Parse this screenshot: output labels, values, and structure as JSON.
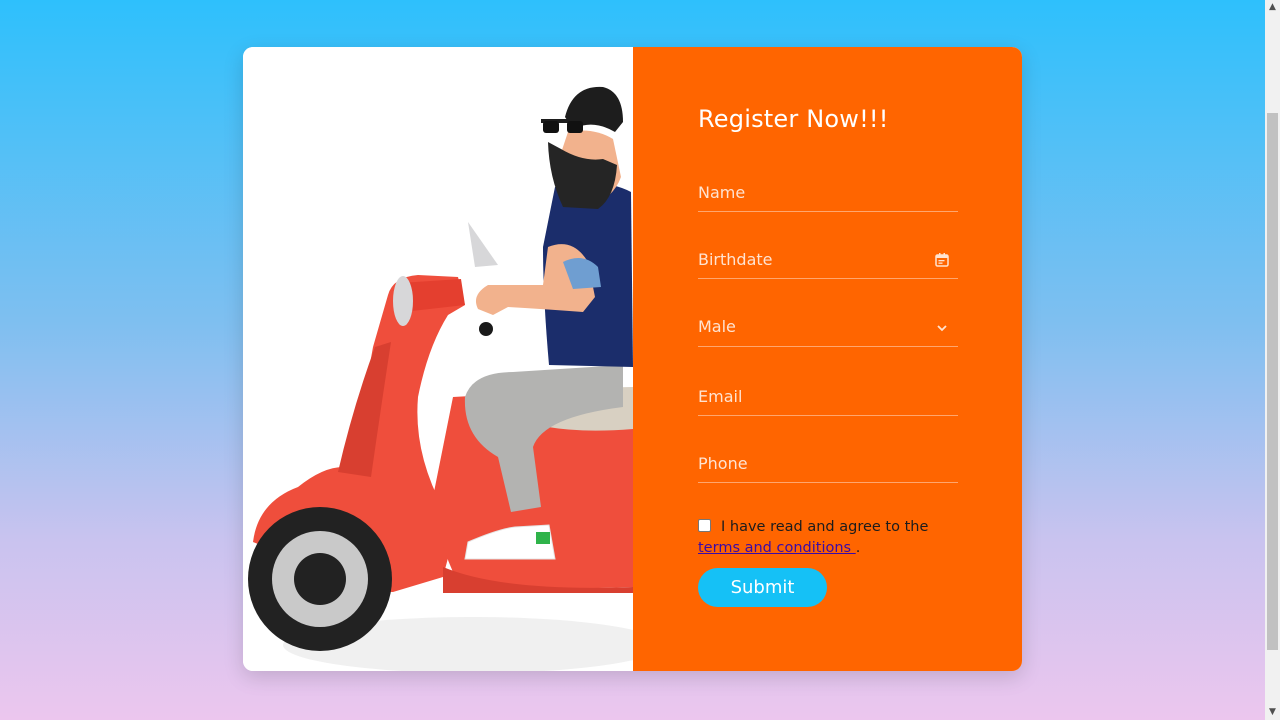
{
  "form": {
    "title": "Register Now!!!",
    "name_placeholder": "Name",
    "birthdate_placeholder": "Birthdate",
    "gender_selected": "Male",
    "email_placeholder": "Email",
    "phone_placeholder": "Phone",
    "consent_text": "I have read and agree to the",
    "terms_link": "terms and conditions ",
    "consent_end": ".",
    "submit_label": "Submit"
  },
  "colors": {
    "panel": "#ff6500",
    "submit": "#15c1f6"
  },
  "icons": {
    "birthdate": "calendar-icon",
    "gender": "chevron-down-icon"
  }
}
